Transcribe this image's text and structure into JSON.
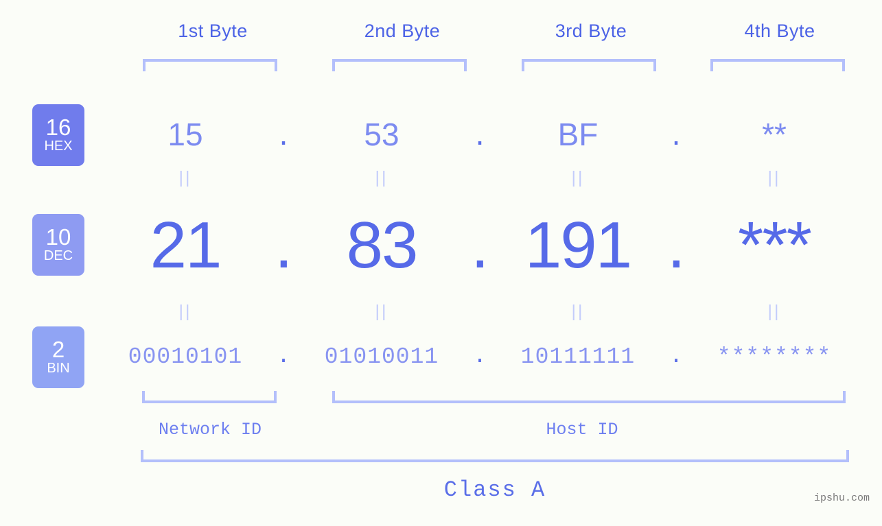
{
  "meta": {
    "watermark": "ipshu.com",
    "background_color": "#fbfdf8",
    "accent_color": "#5a6ee8",
    "bracket_color": "#b3bffb"
  },
  "byte_headers": [
    {
      "label": "1st Byte"
    },
    {
      "label": "2nd Byte"
    },
    {
      "label": "3rd Byte"
    },
    {
      "label": "4th Byte"
    }
  ],
  "rows": {
    "hex": {
      "base": "16",
      "unit": "HEX",
      "badge_color": "#707cec",
      "values": [
        "15",
        "53",
        "BF",
        "**"
      ],
      "separator": "."
    },
    "dec": {
      "base": "10",
      "unit": "DEC",
      "badge_color": "#8e9bf2",
      "values": [
        "21",
        "83",
        "191",
        "***"
      ],
      "separator": "."
    },
    "bin": {
      "base": "2",
      "unit": "BIN",
      "badge_color": "#90a4f4",
      "values": [
        "00010101",
        "01010011",
        "10111111",
        "********"
      ],
      "separator": "."
    }
  },
  "equals_marks": {
    "symbol": "||",
    "count_per_row": 4
  },
  "segments": {
    "network_id": "Network ID",
    "host_id": "Host ID",
    "class": "Class A"
  }
}
